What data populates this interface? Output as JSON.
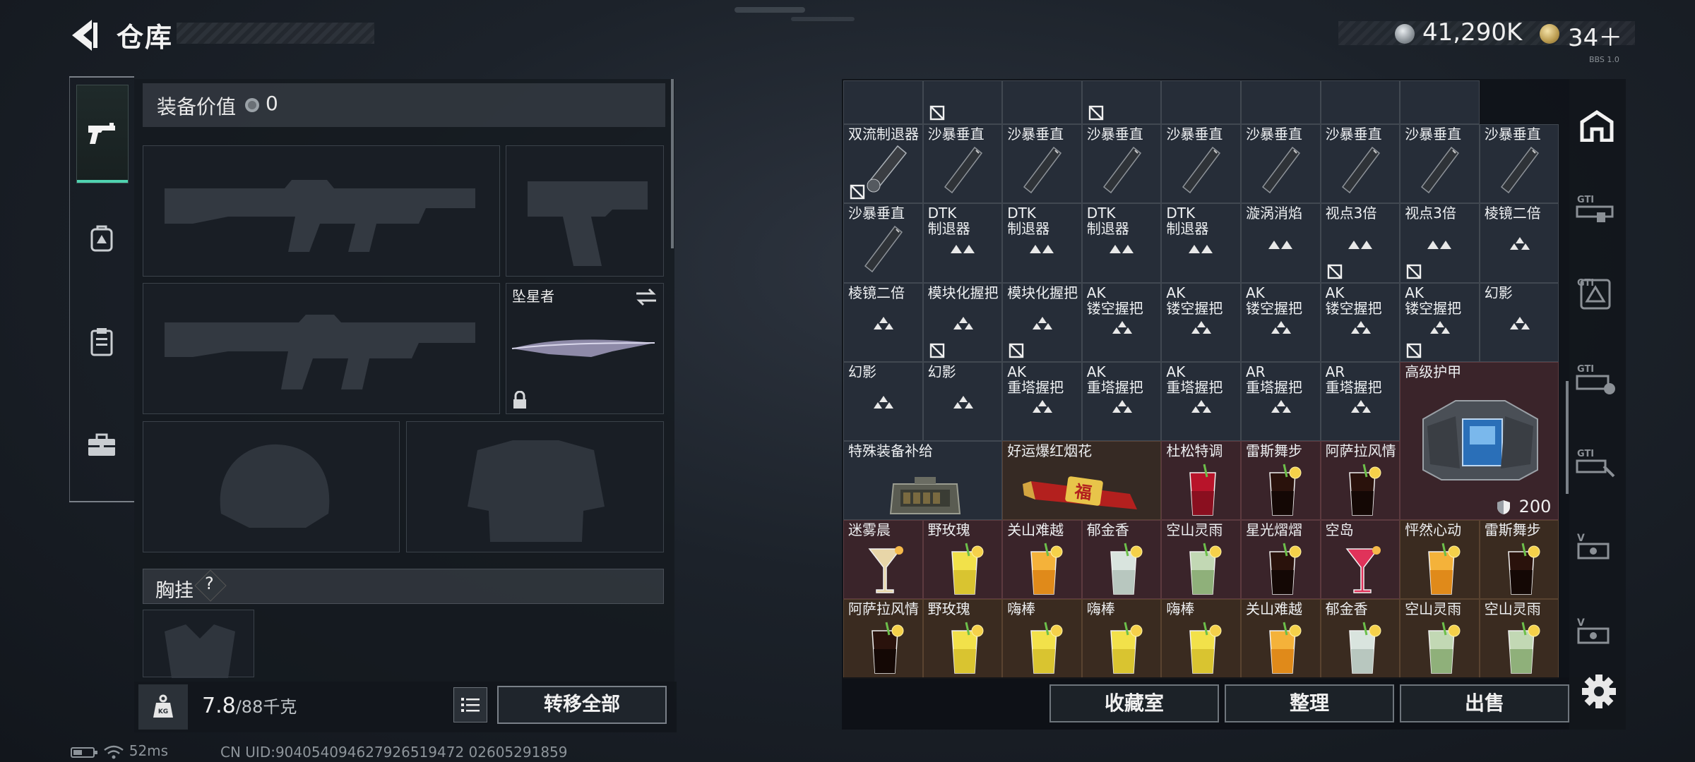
{
  "header": {
    "title": "仓库"
  },
  "currency": {
    "silver": "41,290K",
    "gold": "34＋",
    "tiny": "BBS 1.0"
  },
  "left_tabs": [
    {
      "name": "weapons",
      "icon": "pistol-icon",
      "active": true
    },
    {
      "name": "backpack",
      "icon": "backpack-icon",
      "active": false
    },
    {
      "name": "clipboard",
      "icon": "clipboard-icon",
      "active": false
    },
    {
      "name": "toolbox",
      "icon": "toolbox-icon",
      "active": false
    }
  ],
  "loadout": {
    "value_label": "装备价值",
    "value": "0",
    "melee_name": "坠星者",
    "vest_label": "胸挂",
    "vest_help": "?",
    "weight": "7.8",
    "weight_max": "/88千克",
    "transfer_label": "转移全部"
  },
  "inventory": {
    "cells": [
      {
        "row": 0,
        "col": 0,
        "name": "",
        "bg": "blue",
        "lock": false
      },
      {
        "row": 0,
        "col": 1,
        "name": "",
        "bg": "blue",
        "lock": true
      },
      {
        "row": 0,
        "col": 2,
        "name": "",
        "bg": "blue",
        "lock": false
      },
      {
        "row": 0,
        "col": 3,
        "name": "",
        "bg": "blue",
        "lock": true
      },
      {
        "row": 0,
        "col": 4,
        "name": "",
        "bg": "blue",
        "lock": false
      },
      {
        "row": 0,
        "col": 5,
        "name": "",
        "bg": "blue",
        "lock": false
      },
      {
        "row": 0,
        "col": 6,
        "name": "",
        "bg": "blue",
        "lock": false
      },
      {
        "row": 0,
        "col": 7,
        "name": "",
        "bg": "blue",
        "lock": false
      },
      {
        "row": 1,
        "col": 0,
        "name": "双流制退器",
        "art": "muzzle",
        "lock": true
      },
      {
        "row": 1,
        "col": 1,
        "name": "沙暴垂直",
        "art": "grip"
      },
      {
        "row": 1,
        "col": 2,
        "name": "沙暴垂直",
        "art": "grip"
      },
      {
        "row": 1,
        "col": 3,
        "name": "沙暴垂直",
        "art": "grip"
      },
      {
        "row": 1,
        "col": 4,
        "name": "沙暴垂直",
        "art": "grip"
      },
      {
        "row": 1,
        "col": 5,
        "name": "沙暴垂直",
        "art": "grip"
      },
      {
        "row": 1,
        "col": 6,
        "name": "沙暴垂直",
        "art": "grip"
      },
      {
        "row": 1,
        "col": 7,
        "name": "沙暴垂直",
        "art": "grip"
      },
      {
        "row": 1,
        "col": 8,
        "name": "沙暴垂直",
        "art": "grip"
      },
      {
        "row": 2,
        "col": 0,
        "name": "沙暴垂直",
        "art": "grip"
      },
      {
        "row": 2,
        "col": 1,
        "name": "DTK\n制退器",
        "art": "tri2"
      },
      {
        "row": 2,
        "col": 2,
        "name": "DTK\n制退器",
        "art": "tri2"
      },
      {
        "row": 2,
        "col": 3,
        "name": "DTK\n制退器",
        "art": "tri2"
      },
      {
        "row": 2,
        "col": 4,
        "name": "DTK\n制退器",
        "art": "tri2"
      },
      {
        "row": 2,
        "col": 5,
        "name": "漩涡消焰",
        "art": "tri2"
      },
      {
        "row": 2,
        "col": 6,
        "name": "视点3倍",
        "art": "tri2",
        "lock": true
      },
      {
        "row": 2,
        "col": 7,
        "name": "视点3倍",
        "art": "tri2",
        "lock": true
      },
      {
        "row": 2,
        "col": 8,
        "name": "棱镜二倍",
        "art": "tri3"
      },
      {
        "row": 3,
        "col": 0,
        "name": "棱镜二倍",
        "art": "tri3"
      },
      {
        "row": 3,
        "col": 1,
        "name": "模块化握把",
        "art": "tri3",
        "lock": true
      },
      {
        "row": 3,
        "col": 2,
        "name": "模块化握把",
        "art": "tri3",
        "lock": true
      },
      {
        "row": 3,
        "col": 3,
        "name": "AK\n镂空握把",
        "art": "tri3"
      },
      {
        "row": 3,
        "col": 4,
        "name": "AK\n镂空握把",
        "art": "tri3"
      },
      {
        "row": 3,
        "col": 5,
        "name": "AK\n镂空握把",
        "art": "tri3"
      },
      {
        "row": 3,
        "col": 6,
        "name": "AK\n镂空握把",
        "art": "tri3"
      },
      {
        "row": 3,
        "col": 7,
        "name": "AK\n镂空握把",
        "art": "tri3",
        "lock": true
      },
      {
        "row": 3,
        "col": 8,
        "name": "幻影",
        "art": "tri3"
      },
      {
        "row": 4,
        "col": 0,
        "name": "幻影",
        "art": "tri3"
      },
      {
        "row": 4,
        "col": 1,
        "name": "幻影",
        "art": "tri3"
      },
      {
        "row": 4,
        "col": 2,
        "name": "AK\n重塔握把",
        "art": "tri3"
      },
      {
        "row": 4,
        "col": 3,
        "name": "AK\n重塔握把",
        "art": "tri3"
      },
      {
        "row": 4,
        "col": 4,
        "name": "AK\n重塔握把",
        "art": "tri3"
      },
      {
        "row": 4,
        "col": 5,
        "name": "AR\n重塔握把",
        "art": "tri3"
      },
      {
        "row": 4,
        "col": 6,
        "name": "AR\n重塔握把",
        "art": "tri3"
      },
      {
        "row": 5,
        "col": 0,
        "name": "特殊装备补给",
        "art": "case",
        "w": 2
      },
      {
        "row": 5,
        "col": 2,
        "name": "好运爆红烟花",
        "art": "firework",
        "w": 2,
        "bg": "brown"
      },
      {
        "row": 5,
        "col": 4,
        "name": "杜松特调",
        "art": "drink-red",
        "bg": "red"
      },
      {
        "row": 5,
        "col": 5,
        "name": "雷斯舞步",
        "art": "drink-cola",
        "bg": "red"
      },
      {
        "row": 5,
        "col": 6,
        "name": "阿萨拉风情",
        "art": "drink-cola",
        "bg": "red"
      },
      {
        "row": 6,
        "col": 0,
        "name": "迷雾晨",
        "art": "drink-cocktail",
        "bg": "red"
      },
      {
        "row": 6,
        "col": 1,
        "name": "野玫瑰",
        "art": "drink-yellow",
        "bg": "red"
      },
      {
        "row": 6,
        "col": 2,
        "name": "关山难越",
        "art": "drink-orange",
        "bg": "red"
      },
      {
        "row": 6,
        "col": 3,
        "name": "郁金香",
        "art": "drink-clear",
        "bg": "red"
      },
      {
        "row": 6,
        "col": 4,
        "name": "空山灵雨",
        "art": "drink-green",
        "bg": "red"
      },
      {
        "row": 6,
        "col": 5,
        "name": "星光熠熠",
        "art": "drink-cola",
        "bg": "red"
      },
      {
        "row": 6,
        "col": 6,
        "name": "空岛",
        "art": "drink-pink",
        "bg": "red"
      },
      {
        "row": 6,
        "col": 7,
        "name": "怦然心动",
        "art": "drink-orange",
        "bg": "brown2"
      },
      {
        "row": 6,
        "col": 8,
        "name": "雷斯舞步",
        "art": "drink-cola",
        "bg": "brown2"
      },
      {
        "row": 7,
        "col": 0,
        "name": "阿萨拉风情",
        "art": "drink-cola",
        "bg": "brown2"
      },
      {
        "row": 7,
        "col": 1,
        "name": "野玫瑰",
        "art": "drink-yellow",
        "bg": "brown2"
      },
      {
        "row": 7,
        "col": 2,
        "name": "嗨棒",
        "art": "drink-yellow",
        "bg": "brown2"
      },
      {
        "row": 7,
        "col": 3,
        "name": "嗨棒",
        "art": "drink-yellow",
        "bg": "brown2"
      },
      {
        "row": 7,
        "col": 4,
        "name": "嗨棒",
        "art": "drink-yellow",
        "bg": "brown2"
      },
      {
        "row": 7,
        "col": 5,
        "name": "关山难越",
        "art": "drink-orange",
        "bg": "brown2"
      },
      {
        "row": 7,
        "col": 6,
        "name": "郁金香",
        "art": "drink-clear",
        "bg": "brown2"
      },
      {
        "row": 7,
        "col": 7,
        "name": "空山灵雨",
        "art": "drink-green",
        "bg": "brown2"
      },
      {
        "row": 7,
        "col": 8,
        "name": "空山灵雨",
        "art": "drink-green",
        "bg": "brown2"
      }
    ],
    "armor": {
      "name": "高级护甲",
      "durability": "200"
    }
  },
  "inventory_buttons": {
    "collection": "收藏室",
    "sort": "整理",
    "sell": "出售"
  },
  "right_tabs": [
    "home-vault-icon",
    "gti-weapon-icon",
    "gti-warning-icon",
    "gti-alert-icon",
    "gti-tools-icon",
    "v-tools-icon",
    "v-tools-icon-2"
  ],
  "status": {
    "ping": "52ms",
    "uid": "CN UID:904054094627926519472 02605291859"
  },
  "colors": {
    "accent": "#4fd3b0",
    "panel": "#262d38",
    "red_cell": "#3a242a"
  }
}
